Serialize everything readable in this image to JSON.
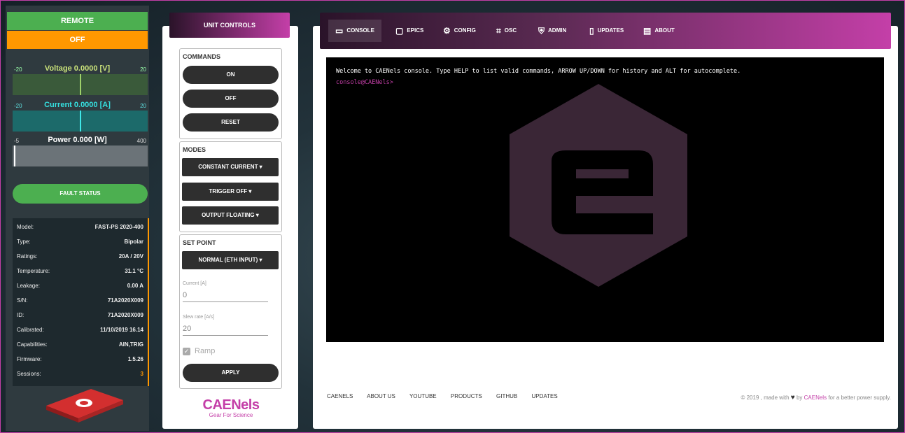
{
  "status": {
    "remote": "REMOTE",
    "output": "OFF"
  },
  "meters": [
    {
      "title": "Voltage 0.0000 [V]",
      "min": "-20",
      "max": "20",
      "value": 0.0
    },
    {
      "title": "Current 0.0000 [A]",
      "min": "-20",
      "max": "20",
      "value": 0.0
    },
    {
      "title": "Power 0.000 [W]",
      "min": "-5",
      "max": "400",
      "value": 0.0
    }
  ],
  "fault_status": "FAULT STATUS",
  "info": [
    {
      "k": "Model:",
      "v": "FAST-PS 2020-400"
    },
    {
      "k": "Type:",
      "v": "Bipolar"
    },
    {
      "k": "Ratings:",
      "v": "20A / 20V"
    },
    {
      "k": "Temperature:",
      "v": "31.1 °C"
    },
    {
      "k": "Leakage:",
      "v": "0.00 A"
    },
    {
      "k": "S/N:",
      "v": "71A2020X009"
    },
    {
      "k": "ID:",
      "v": "71A2020X009"
    },
    {
      "k": "Calibrated:",
      "v": "11/10/2019 16.14"
    },
    {
      "k": "Capabilities:",
      "v": "AIN,TRIG"
    },
    {
      "k": "Firmware:",
      "v": "1.5.26"
    },
    {
      "k": "Sessions:",
      "v": "3"
    }
  ],
  "unit_controls": {
    "title": "UNIT CONTROLS",
    "commands": {
      "title": "COMMANDS",
      "on": "ON",
      "off": "OFF",
      "reset": "RESET"
    },
    "modes": {
      "title": "MODES",
      "mode": "CONSTANT CURRENT ▾",
      "trigger": "TRIGGER OFF ▾",
      "output": "OUTPUT FLOATING ▾"
    },
    "setpoint": {
      "title": "SET POINT",
      "source": "NORMAL (ETH INPUT) ▾",
      "current_label": "Current [A]",
      "current_value": "0",
      "slew_label": "Slew rate [A/s]",
      "slew_value": "20",
      "ramp_label": "Ramp",
      "apply": "APPLY"
    },
    "logo": {
      "name": "CAENels",
      "tagline": "Gear For Science"
    }
  },
  "tabs": [
    {
      "label": "CONSOLE",
      "icon": "monitor-icon",
      "glyph": "▭"
    },
    {
      "label": "EPICS",
      "icon": "rounded-rect-icon",
      "glyph": "▢"
    },
    {
      "label": "CONFIG",
      "icon": "gear-icon",
      "glyph": "⚙"
    },
    {
      "label": "OSC",
      "icon": "oscilloscope-icon",
      "glyph": "⌗"
    },
    {
      "label": "ADMIN",
      "icon": "shield-icon",
      "glyph": "⛨"
    },
    {
      "label": "UPDATES",
      "icon": "tablet-icon",
      "glyph": "▯"
    },
    {
      "label": "ABOUT",
      "icon": "id-card-icon",
      "glyph": "▤"
    }
  ],
  "console": {
    "welcome": "Welcome to CAENels console. Type HELP to list valid commands, ARROW UP/DOWN for history and ALT for autocomplete.",
    "prompt": "console@CAENels>"
  },
  "footer": {
    "links": [
      "CAENELS",
      "ABOUT US",
      "YOUTUBE",
      "PRODUCTS",
      "GITHUB",
      "UPDATES"
    ],
    "copy_pre": "© 2019 , made with",
    "copy_heart": "♥",
    "copy_by": "by",
    "copy_brand": "CAENels",
    "copy_post": "for a better power supply."
  },
  "colors": {
    "accent": "#c43fa8",
    "ok": "#4caf50",
    "warn": "#ff9800",
    "console_bg": "#000000"
  }
}
